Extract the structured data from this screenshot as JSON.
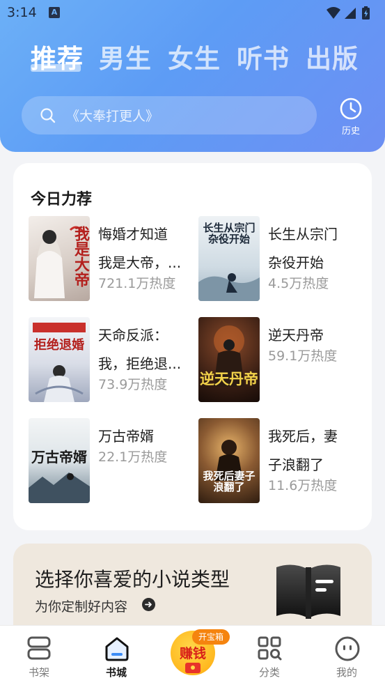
{
  "status": {
    "time": "3:14",
    "notif_letter": "A"
  },
  "tabs": [
    {
      "label": "推荐",
      "active": true
    },
    {
      "label": "男生",
      "active": false
    },
    {
      "label": "女生",
      "active": false
    },
    {
      "label": "听书",
      "active": false
    },
    {
      "label": "出版",
      "active": false
    }
  ],
  "search": {
    "placeholder": "《大奉打更人》",
    "icon": "search-icon"
  },
  "history": {
    "label": "历史",
    "icon": "clock-icon"
  },
  "recommend": {
    "title": "今日力荐",
    "books": [
      {
        "title_lines": [
          "悔婚才知道",
          "我是大帝，..."
        ],
        "heat": "721.1万热度",
        "cover_text": "我是大帝",
        "cover_bg": "#eae2dc",
        "cover_fg": "#b3201d"
      },
      {
        "title_lines": [
          "长生从宗门",
          "杂役开始"
        ],
        "heat": "4.5万热度",
        "cover_text": "长生从宗门杂役开始",
        "cover_bg": "#dfe8ef",
        "cover_fg": "#1d2a3a"
      },
      {
        "title_lines": [
          "天命反派：",
          "我，拒绝退..."
        ],
        "heat": "73.9万热度",
        "cover_text": "拒绝退婚",
        "cover_bg": "#e6e9f0",
        "cover_fg": "#b3201d"
      },
      {
        "title_lines": [
          "逆天丹帝"
        ],
        "heat": "59.1万热度",
        "cover_text": "逆天丹帝",
        "cover_bg": "#3a1f14",
        "cover_fg": "#f2d24a"
      },
      {
        "title_lines": [
          "万古帝婿"
        ],
        "heat": "22.1万热度",
        "cover_text": "万古帝婿",
        "cover_bg": "#dfe6ea",
        "cover_fg": "#1a1a1a"
      },
      {
        "title_lines": [
          "我死后，妻",
          "子浪翻了"
        ],
        "heat": "11.6万热度",
        "cover_text": "我死后妻子浪翻了",
        "cover_bg": "#5a3b22",
        "cover_fg": "#ffffff"
      }
    ]
  },
  "banner": {
    "title": "选择你喜爱的小说类型",
    "subtitle": "为你定制好内容"
  },
  "bottom_nav": {
    "items": [
      {
        "label": "书架",
        "icon": "bookshelf-icon",
        "active": false
      },
      {
        "label": "书城",
        "icon": "home-icon",
        "active": true
      },
      {
        "label": "",
        "icon": "earn-money-icon",
        "active": false
      },
      {
        "label": "分类",
        "icon": "category-icon",
        "active": false
      },
      {
        "label": "我的",
        "icon": "profile-icon",
        "active": false
      }
    ],
    "earn_text": "赚钱",
    "earn_badge": "开宝箱"
  },
  "colors": {
    "header_top": "#6cb0f7",
    "header_bottom": "#6d8ff3",
    "accent_orange": "#f5840f",
    "muted": "#9a9a9a"
  }
}
